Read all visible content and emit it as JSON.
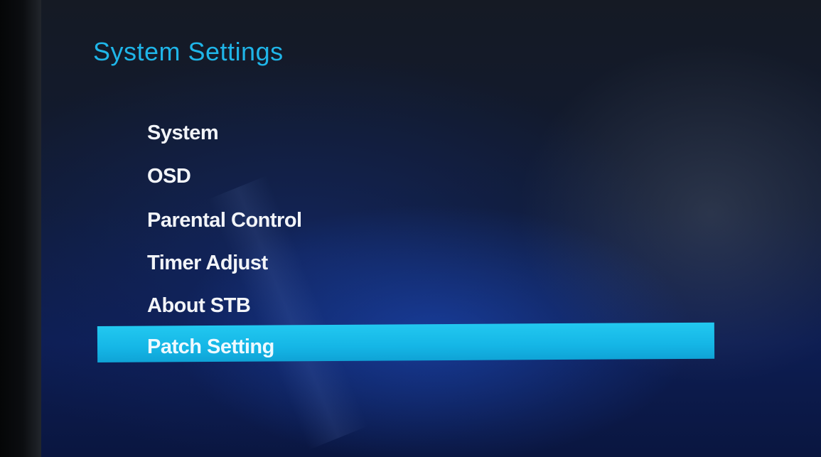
{
  "screen": {
    "title": "System Settings"
  },
  "menu": {
    "items": [
      {
        "label": "System"
      },
      {
        "label": "OSD"
      },
      {
        "label": "Parental Control"
      },
      {
        "label": "Timer Adjust"
      },
      {
        "label": "About STB"
      },
      {
        "label": "Patch Setting"
      }
    ],
    "selected_index": 5
  },
  "colors": {
    "title": "#1fb5e8",
    "highlight": "#1bbdee",
    "item_text": "#f2f4f8",
    "background": "#0d1d52"
  }
}
